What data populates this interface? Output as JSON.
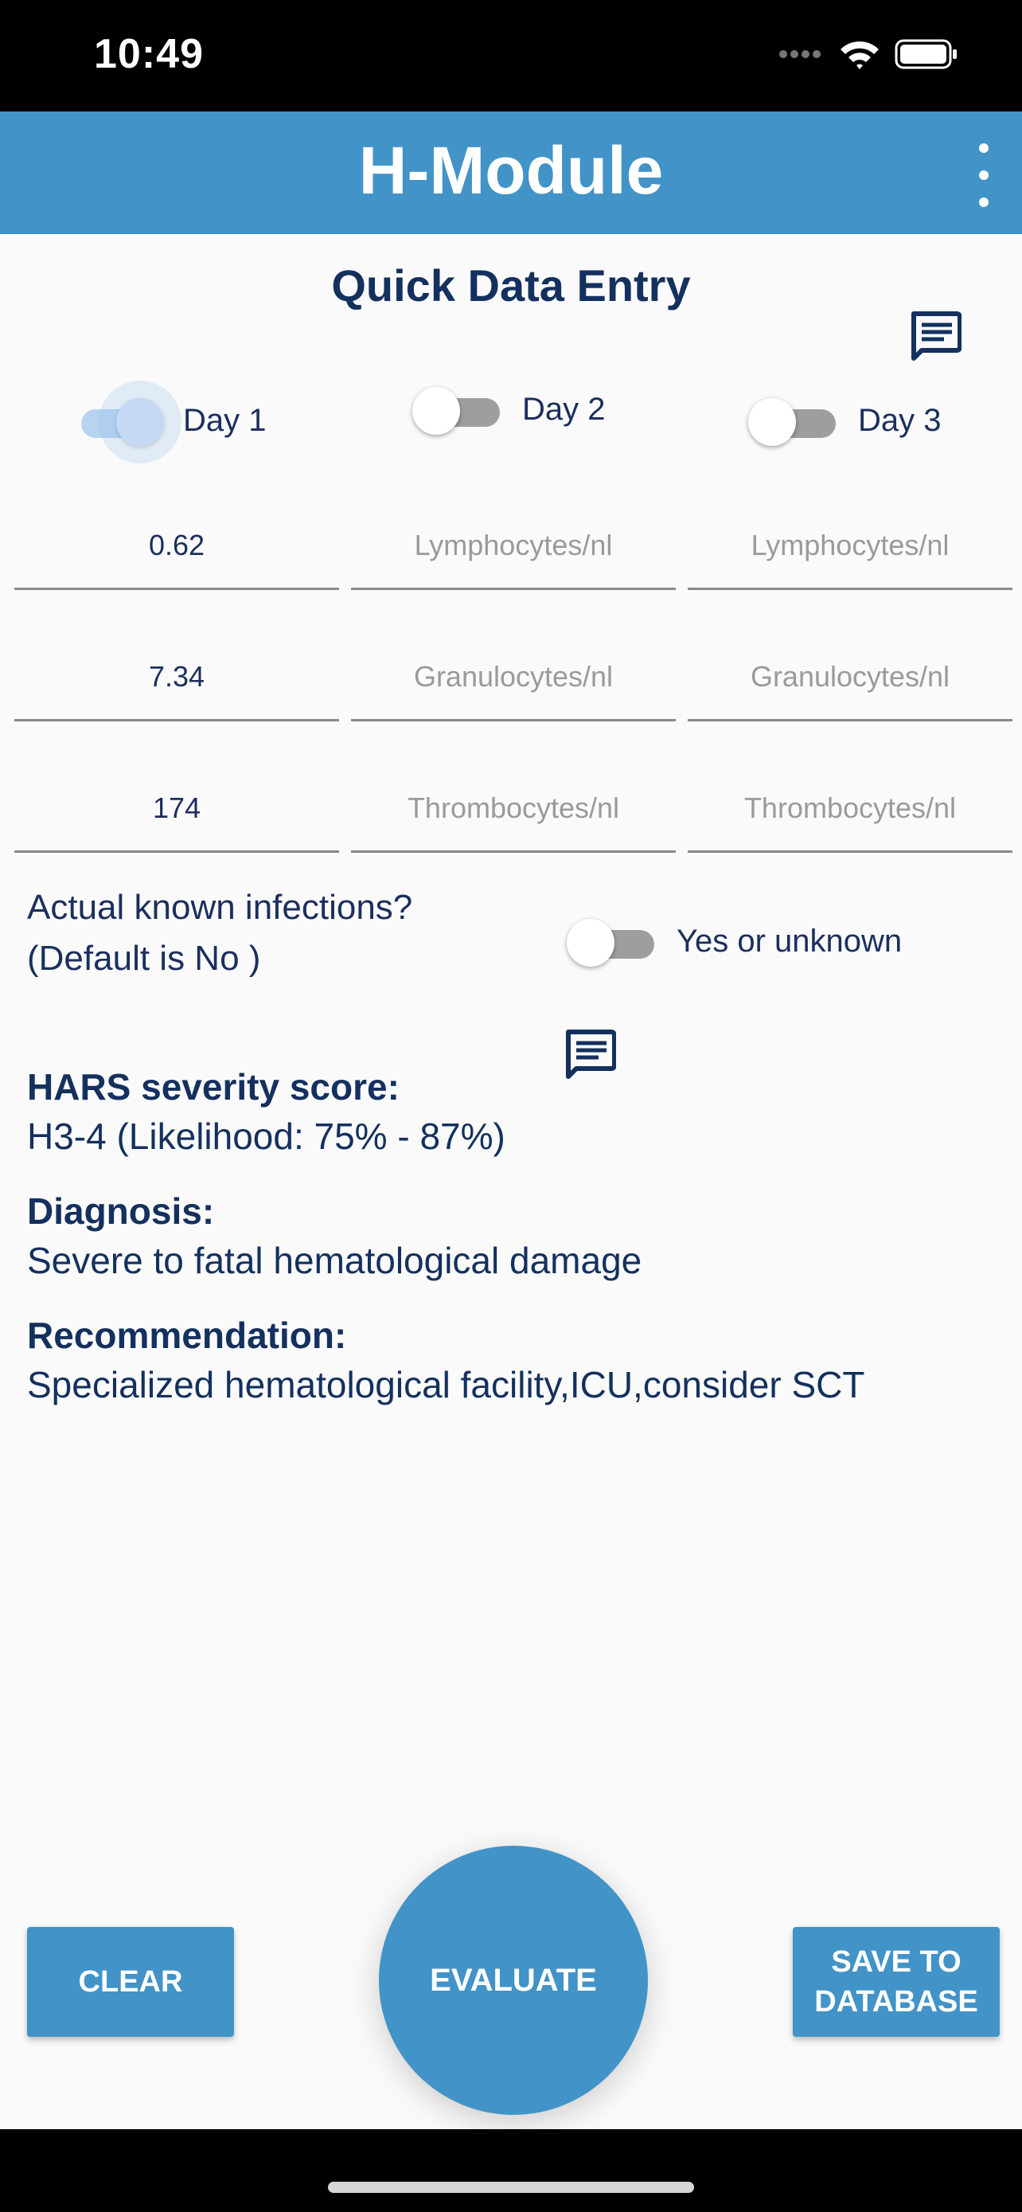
{
  "status_bar": {
    "time": "10:49",
    "icons": [
      "signal-icon",
      "wifi-icon",
      "battery-icon"
    ]
  },
  "app_bar": {
    "title": "H-Module",
    "menu_icon": "more-vert-icon"
  },
  "page": {
    "title": "Quick Data Entry"
  },
  "days": [
    {
      "label": "Day 1",
      "enabled": true,
      "lymphocytes": {
        "value": "0.62",
        "placeholder": "Lymphocytes/nl"
      },
      "granulocytes": {
        "value": "7.34",
        "placeholder": "Granulocytes/nl"
      },
      "thrombocytes": {
        "value": "174",
        "placeholder": "Thrombocytes/nl"
      }
    },
    {
      "label": "Day 2",
      "enabled": false,
      "lymphocytes": {
        "value": "",
        "placeholder": "Lymphocytes/nl"
      },
      "granulocytes": {
        "value": "",
        "placeholder": "Granulocytes/nl"
      },
      "thrombocytes": {
        "value": "",
        "placeholder": "Thrombocytes/nl"
      }
    },
    {
      "label": "Day 3",
      "enabled": false,
      "lymphocytes": {
        "value": "",
        "placeholder": "Lymphocytes/nl"
      },
      "granulocytes": {
        "value": "",
        "placeholder": "Granulocytes/nl"
      },
      "thrombocytes": {
        "value": "",
        "placeholder": "Thrombocytes/nl"
      }
    }
  ],
  "infections": {
    "question_line1": "Actual known infections?",
    "question_line2": "(Default is No )",
    "toggle_label": "Yes or unknown",
    "enabled": false
  },
  "results": {
    "hars_label": "HARS severity score:",
    "hars_value": "H3-4 (Likelihood: 75% - 87%)",
    "diagnosis_label": "Diagnosis:",
    "diagnosis_value": "Severe to fatal hematological damage",
    "recommendation_label": "Recommendation:",
    "recommendation_value": "Specialized hematological facility,ICU,consider SCT"
  },
  "buttons": {
    "clear": "CLEAR",
    "evaluate": "EVALUATE",
    "save_line1": "SAVE TO",
    "save_line2": "DATABASE"
  },
  "colors": {
    "accent": "#4293c7",
    "text": "#14305e",
    "background": "#fafafa"
  }
}
